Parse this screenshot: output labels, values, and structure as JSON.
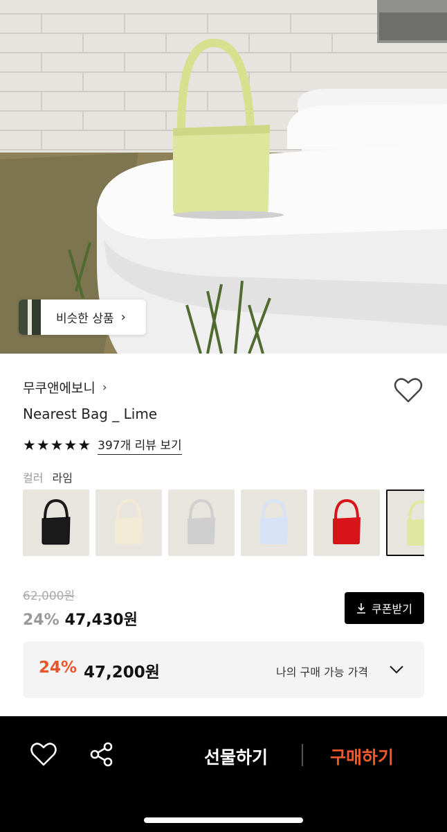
{
  "hero": {
    "similar_button": {
      "label": "비슷한 상품",
      "chevron": "›"
    }
  },
  "product": {
    "brand": "무쿠앤에보니",
    "brand_chevron": "›",
    "title": "Nearest Bag _ Lime",
    "rating": {
      "stars": 5,
      "star_glyph": "★",
      "review_text": "397개 리뷰 보기"
    },
    "color": {
      "label": "컬러",
      "value": "라임"
    },
    "swatches": [
      {
        "name": "black",
        "color": "#1a1a1a",
        "selected": false
      },
      {
        "name": "cream",
        "color": "#f3ead6",
        "selected": false
      },
      {
        "name": "silver",
        "color": "#cfcfcf",
        "selected": false
      },
      {
        "name": "light-blue",
        "color": "#d6e2f5",
        "selected": false
      },
      {
        "name": "red",
        "color": "#d8141b",
        "selected": false
      },
      {
        "name": "lime",
        "color": "#dfe8a0",
        "selected": true
      }
    ]
  },
  "price": {
    "original": "62,000원",
    "discount": "24%",
    "sale": "47,430원",
    "coupon_button": "쿠폰받기",
    "my_price": {
      "discount": "24%",
      "price": "47,200원",
      "label": "나의 구매 가능 가격"
    }
  },
  "bottom_bar": {
    "gift": "선물하기",
    "buy": "구매하기"
  },
  "colors": {
    "accent": "#f05a2a",
    "my_price_discount": "#e8552b",
    "bottom_bar_bg": "#000000"
  },
  "icons": [
    "heart-icon",
    "share-icon",
    "download-icon",
    "chevron-down-icon",
    "star-icon",
    "chevron-right-icon"
  ]
}
